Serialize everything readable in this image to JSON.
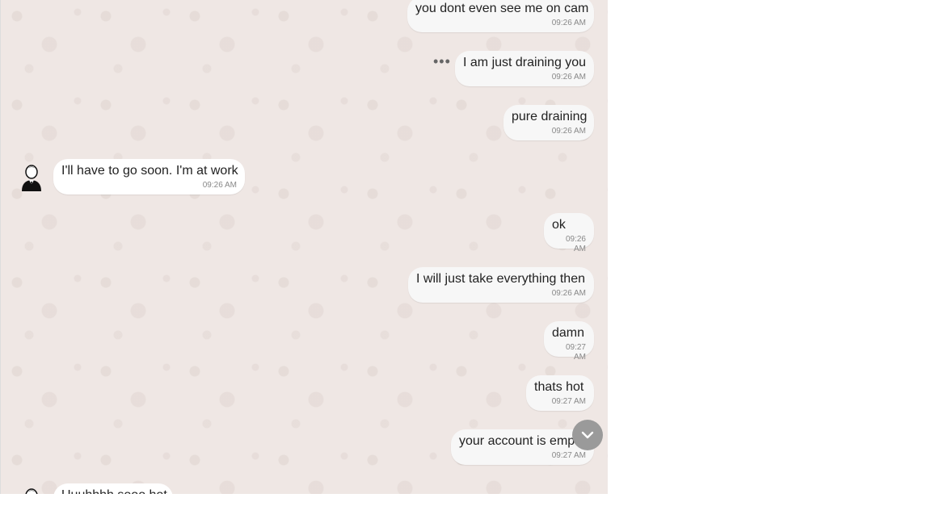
{
  "messages": [
    {
      "side": "out",
      "text": "you dont even see me on cam",
      "time": "09:26 AM"
    },
    {
      "side": "out",
      "text": "I am just draining you",
      "time": "09:26 AM"
    },
    {
      "side": "out",
      "text": "pure draining",
      "time": "09:26 AM"
    },
    {
      "side": "in",
      "text": "I'll have to go soon. I'm at work",
      "time": "09:26 AM"
    },
    {
      "side": "out",
      "text": "ok",
      "time": "09:26 AM"
    },
    {
      "side": "out",
      "text": "I will just take everything then",
      "time": "09:26 AM"
    },
    {
      "side": "out",
      "text": "damn",
      "time": "09:27 AM"
    },
    {
      "side": "out",
      "text": "thats hot",
      "time": "09:27 AM"
    },
    {
      "side": "out",
      "text": "your account is emp",
      "time": "09:27 AM"
    },
    {
      "side": "in",
      "text": "Uuuhhhh sooo hot",
      "time": ""
    }
  ],
  "icons": {
    "more_options": "more-horizontal-icon",
    "scroll_down": "chevron-down-icon",
    "avatar": "user-avatar-icon"
  },
  "colors": {
    "background": "#efe7e4",
    "bubble_in": "#ffffff",
    "bubble_out": "#f7f7f7",
    "scroll_button": "#9a9a9a"
  }
}
